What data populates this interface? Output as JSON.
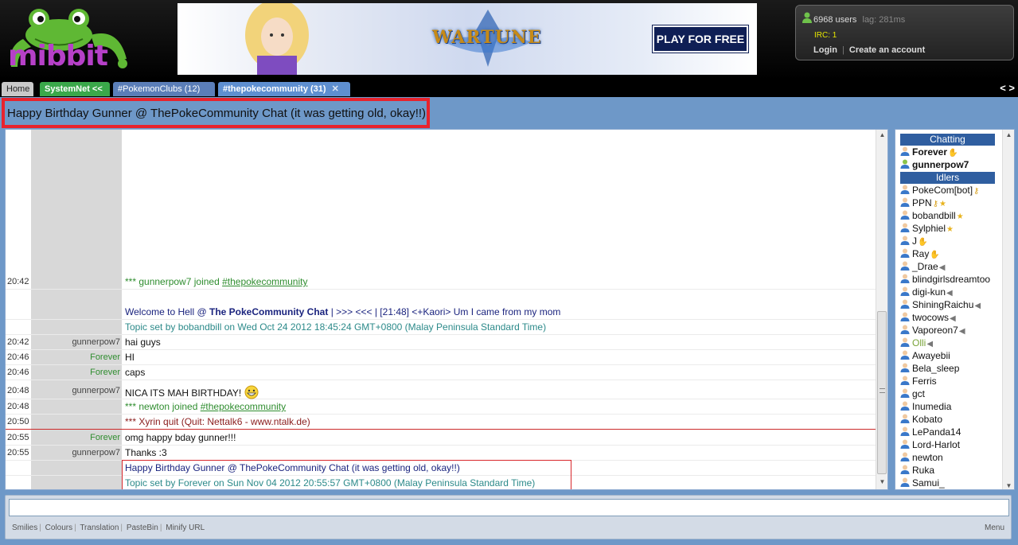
{
  "header": {
    "logo_text": "mibbit",
    "ad": {
      "game_title": "WARTUNE",
      "cta": "PLAY FOR FREE"
    },
    "user_panel": {
      "count": "6968 users",
      "lag": "lag: 281ms",
      "irc": "IRC: 1",
      "login": "Login",
      "create_account": "Create an account"
    }
  },
  "tabs": [
    {
      "label": "Home"
    },
    {
      "label": "SystemNet <<"
    },
    {
      "label": "#PokemonClubs (12)"
    },
    {
      "label": "#thepokecommunity (31)"
    }
  ],
  "tab_arrows": "< >",
  "topic": "Happy Birthday Gunner @ ThePokeCommunity Chat (it was getting old, okay!!)",
  "chat": {
    "lines": [
      {
        "time": "20:42",
        "nick": "",
        "pre": "*** gunnerpow7 joined ",
        "link": "#thepokecommunity",
        "type": "sys"
      },
      {
        "time": "",
        "nick": "",
        "pre": "Welcome to Hell @ ",
        "bold": "The PokeCommunity Chat",
        "post": " | >>>          <<< | [21:48] <+Kaori> Um I came from my mom",
        "type": "welcome"
      },
      {
        "time": "",
        "nick": "",
        "text": "Topic set by bobandbill on Wed Oct 24 2012 18:45:24 GMT+0800 (Malay Peninsula Standard Time)",
        "type": "topicset"
      },
      {
        "time": "20:42",
        "nick": "gunnerpow7",
        "text": "hai guys",
        "type": "msg"
      },
      {
        "time": "20:46",
        "nick": "Forever",
        "text": "HI",
        "type": "msg",
        "nickcolor": "green"
      },
      {
        "time": "20:46",
        "nick": "Forever",
        "text": "caps",
        "type": "msg",
        "nickcolor": "green"
      },
      {
        "time": "20:48",
        "nick": "gunnerpow7",
        "text": "NICA ITS MAH BIRTHDAY!",
        "type": "msg"
      },
      {
        "time": "20:48",
        "nick": "",
        "pre": "*** newton joined ",
        "link": "#thepokecommunity",
        "type": "sys"
      },
      {
        "time": "20:50",
        "nick": "",
        "text": "*** Xyrin quit (Quit: Nettalk6 - www.ntalk.de)",
        "type": "sysred"
      },
      {
        "time": "20:55",
        "nick": "Forever",
        "text": "omg happy bday gunner!!!",
        "type": "msg",
        "nickcolor": "green"
      },
      {
        "time": "20:55",
        "nick": "gunnerpow7",
        "text": "Thanks :3",
        "type": "msg"
      },
      {
        "time": "",
        "nick": "",
        "text": "Happy Birthday Gunner @ ThePokeCommunity Chat (it was getting old, okay!!)",
        "type": "welcome"
      },
      {
        "time": "",
        "nick": "",
        "text": "Topic set by Forever on Sun Nov 04 2012 20:55:57 GMT+0800 (Malay Peninsula Standard Time)",
        "type": "topicset"
      }
    ]
  },
  "nicklist": {
    "chatting_label": "Chatting",
    "idlers_label": "Idlers",
    "chatting": [
      {
        "name": "Forever",
        "badge": "hand"
      },
      {
        "name": "gunnerpow7",
        "badge": ""
      }
    ],
    "idlers": [
      {
        "name": "PokeCom[bot]",
        "badge": "key"
      },
      {
        "name": "PPN",
        "badge": "keystar"
      },
      {
        "name": "bobandbill",
        "badge": "star"
      },
      {
        "name": "Sylphiel",
        "badge": "star"
      },
      {
        "name": "J",
        "badge": "hand"
      },
      {
        "name": "Ray",
        "badge": "hand"
      },
      {
        "name": "_Drae",
        "badge": "mute"
      },
      {
        "name": "blindgirlsdreamtoo",
        "badge": ""
      },
      {
        "name": "digi-kun",
        "badge": "mute"
      },
      {
        "name": "ShiningRaichu",
        "badge": "mute"
      },
      {
        "name": "twocows",
        "badge": "mute"
      },
      {
        "name": "Vaporeon7",
        "badge": "mute"
      },
      {
        "name": "Olli",
        "badge": "mute"
      },
      {
        "name": "Awayebii",
        "badge": ""
      },
      {
        "name": "Bela_sleep",
        "badge": ""
      },
      {
        "name": "Ferris",
        "badge": ""
      },
      {
        "name": "gct",
        "badge": ""
      },
      {
        "name": "Inumedia",
        "badge": ""
      },
      {
        "name": "Kobato",
        "badge": ""
      },
      {
        "name": "LePanda14",
        "badge": ""
      },
      {
        "name": "Lord-Harlot",
        "badge": ""
      },
      {
        "name": "newton",
        "badge": ""
      },
      {
        "name": "Ruka",
        "badge": ""
      },
      {
        "name": "Samui_",
        "badge": ""
      }
    ]
  },
  "input": {
    "value": ""
  },
  "toolbar": {
    "items": [
      "Smilies",
      "Colours",
      "Translation",
      "PasteBin",
      "Minify URL"
    ],
    "menu": "Menu"
  },
  "colors": {
    "accent": "#6e98c8",
    "highlight": "#e8232d",
    "nick_green": "#2f8d2f"
  }
}
